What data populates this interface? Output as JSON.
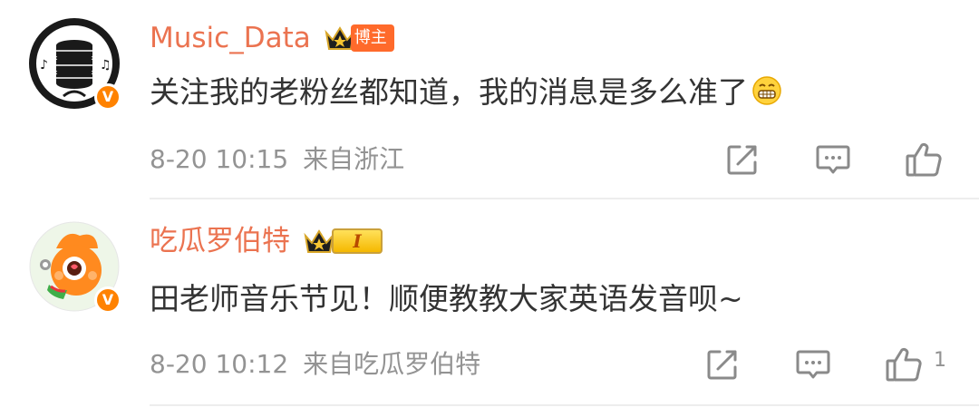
{
  "comments": [
    {
      "username": "Music_Data",
      "badge": "博主",
      "text": "关注我的老粉丝都知道，我的消息是多么准了",
      "emoji_icon": "grin-emoji-icon",
      "date": "8-20 10:15",
      "location": "来自浙江",
      "like_count": ""
    },
    {
      "username": "吃瓜罗伯特",
      "badge": "I",
      "text": "田老师音乐节见！顺便教教大家英语发音呗~",
      "date": "8-20 10:12",
      "location": "来自吃瓜罗伯特",
      "like_count": "1"
    }
  ],
  "icons": {
    "verified": "verified-v-icon",
    "forward": "forward-icon",
    "comment": "comment-icon",
    "like": "thumbs-up-icon",
    "crown": "crown-icon"
  },
  "colors": {
    "username": "#eb7350",
    "verified": "#ff8200",
    "meta": "#939393",
    "text": "#333333"
  }
}
